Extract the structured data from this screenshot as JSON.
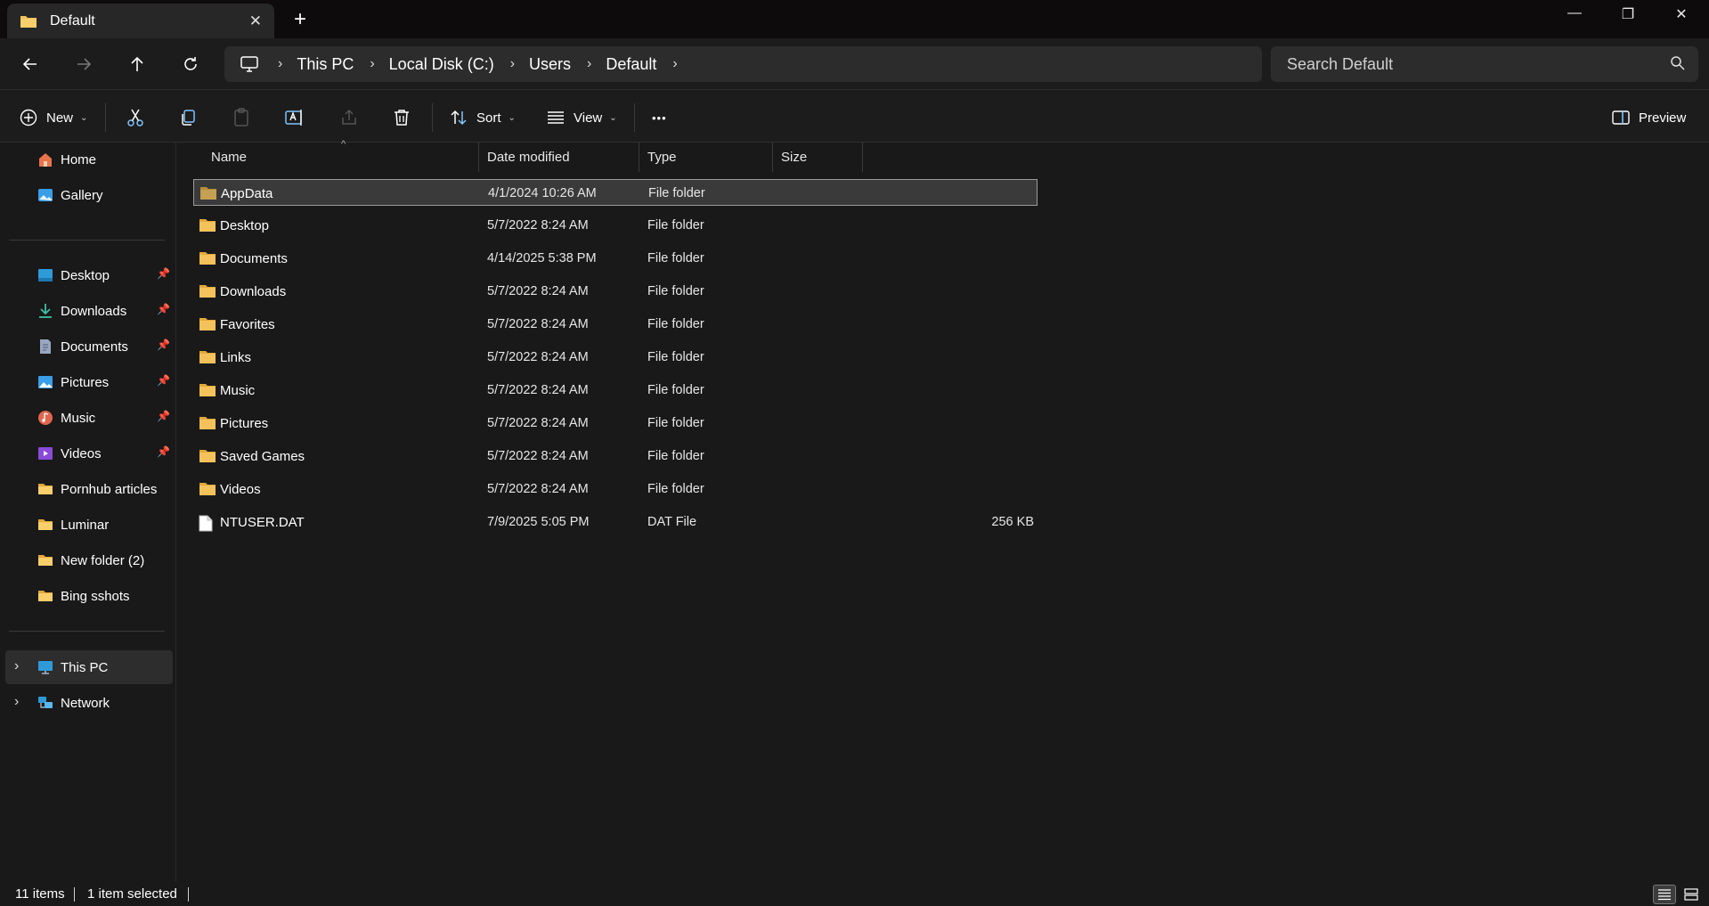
{
  "tab": {
    "title": "Default",
    "close": "✕",
    "new_tab": "+"
  },
  "window_controls": {
    "minimize": "—",
    "restore": "❐",
    "close": "✕"
  },
  "nav": {
    "back": "←",
    "forward": "→",
    "up": "↑",
    "refresh": "↻"
  },
  "breadcrumb": [
    "This PC",
    "Local Disk (C:)",
    "Users",
    "Default"
  ],
  "search": {
    "placeholder": "Search Default"
  },
  "commands": {
    "new": "New",
    "sort": "Sort",
    "view": "View",
    "more": "•••",
    "preview": "Preview"
  },
  "sidebar": {
    "top": [
      {
        "label": "Home",
        "icon": "home-icon"
      },
      {
        "label": "Gallery",
        "icon": "gallery-icon"
      }
    ],
    "pinned": [
      {
        "label": "Desktop",
        "icon": "desktop-icon",
        "pinned": true
      },
      {
        "label": "Downloads",
        "icon": "downloads-icon",
        "pinned": true
      },
      {
        "label": "Documents",
        "icon": "documents-icon",
        "pinned": true
      },
      {
        "label": "Pictures",
        "icon": "pictures-icon",
        "pinned": true
      },
      {
        "label": "Music",
        "icon": "music-icon",
        "pinned": true
      },
      {
        "label": "Videos",
        "icon": "videos-icon",
        "pinned": true
      },
      {
        "label": "Pornhub articles",
        "icon": "folder-icon",
        "pinned": false
      },
      {
        "label": "Luminar",
        "icon": "folder-icon",
        "pinned": false
      },
      {
        "label": "New folder (2)",
        "icon": "folder-icon",
        "pinned": false
      },
      {
        "label": "Bing sshots",
        "icon": "folder-icon",
        "pinned": false
      }
    ],
    "locations": [
      {
        "label": "This PC",
        "icon": "this-pc-icon",
        "selected": true
      },
      {
        "label": "Network",
        "icon": "network-icon",
        "selected": false
      }
    ]
  },
  "columns": {
    "name": "Name",
    "date": "Date modified",
    "type": "Type",
    "size": "Size"
  },
  "files": [
    {
      "name": "AppData",
      "date": "4/1/2024 10:26 AM",
      "type": "File folder",
      "size": "",
      "kind": "folder",
      "selected": true
    },
    {
      "name": "Desktop",
      "date": "5/7/2022 8:24 AM",
      "type": "File folder",
      "size": "",
      "kind": "folder"
    },
    {
      "name": "Documents",
      "date": "4/14/2025 5:38 PM",
      "type": "File folder",
      "size": "",
      "kind": "folder"
    },
    {
      "name": "Downloads",
      "date": "5/7/2022 8:24 AM",
      "type": "File folder",
      "size": "",
      "kind": "folder"
    },
    {
      "name": "Favorites",
      "date": "5/7/2022 8:24 AM",
      "type": "File folder",
      "size": "",
      "kind": "folder"
    },
    {
      "name": "Links",
      "date": "5/7/2022 8:24 AM",
      "type": "File folder",
      "size": "",
      "kind": "folder"
    },
    {
      "name": "Music",
      "date": "5/7/2022 8:24 AM",
      "type": "File folder",
      "size": "",
      "kind": "folder"
    },
    {
      "name": "Pictures",
      "date": "5/7/2022 8:24 AM",
      "type": "File folder",
      "size": "",
      "kind": "folder"
    },
    {
      "name": "Saved Games",
      "date": "5/7/2022 8:24 AM",
      "type": "File folder",
      "size": "",
      "kind": "folder"
    },
    {
      "name": "Videos",
      "date": "5/7/2022 8:24 AM",
      "type": "File folder",
      "size": "",
      "kind": "folder"
    },
    {
      "name": "NTUSER.DAT",
      "date": "7/9/2025 5:05 PM",
      "type": "DAT File",
      "size": "256 KB",
      "kind": "file"
    }
  ],
  "status": {
    "count": "11 items",
    "selection": "1 item selected"
  },
  "colors": {
    "folder": "#f4c25a",
    "folder_dark": "#e0a93a",
    "accent": "#4cc2ff"
  }
}
